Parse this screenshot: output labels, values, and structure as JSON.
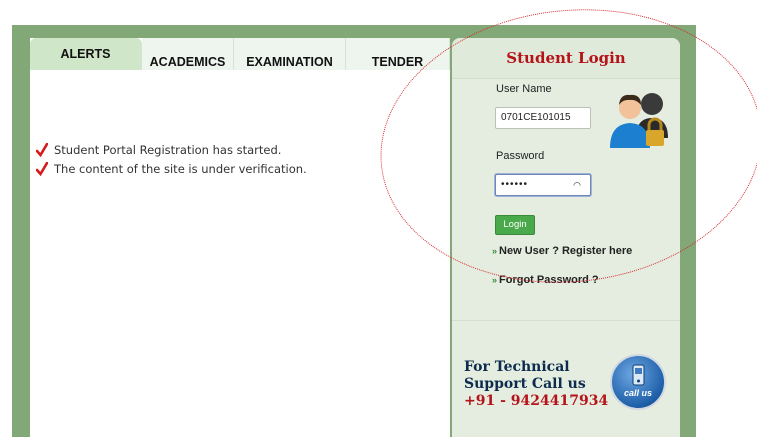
{
  "tabs": [
    {
      "label": "ALERTS",
      "active": true
    },
    {
      "label": "ACADEMICS",
      "active": false
    },
    {
      "label": "EXAMINATION",
      "active": false
    },
    {
      "label": "TENDER",
      "active": false
    }
  ],
  "alerts": [
    "Student Portal Registration has started.",
    "The content of the site is under verification."
  ],
  "login": {
    "title": "Student Login",
    "username_label": "User Name",
    "username_value": "0701CE101015",
    "password_label": "Password",
    "password_value": "••••••",
    "login_button": "Login",
    "register_link": "New User ? Register here",
    "forgot_link": "Forgot Password ?"
  },
  "support": {
    "line1": "For Technical",
    "line2": "Support Call us",
    "phone": "+91 - 9424417934",
    "badge": "call us"
  },
  "colors": {
    "accent_red": "#b5131a",
    "frame_green": "#82a878",
    "button_green": "#4aa94a"
  }
}
